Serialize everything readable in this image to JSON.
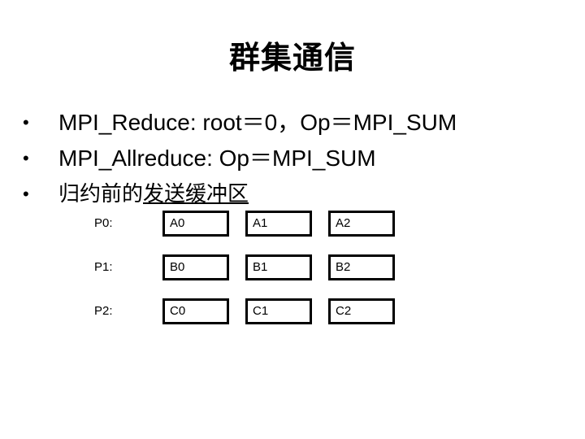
{
  "title": "群集通信",
  "bullets": [
    {
      "marker": "•",
      "text": "MPI_Reduce: root＝0，Op＝MPI_SUM"
    },
    {
      "marker": "•",
      "text": "MPI_Allreduce:  Op＝MPI_SUM"
    },
    {
      "marker": "•",
      "text_plain": "归约前的",
      "text_underlined": "发送缓冲区"
    }
  ],
  "buffer_table": {
    "rows": [
      {
        "label": "P0:",
        "cells": [
          "A0",
          "A1",
          "A2"
        ]
      },
      {
        "label": "P1:",
        "cells": [
          "B0",
          "B1",
          "B2"
        ]
      },
      {
        "label": "P2:",
        "cells": [
          "C0",
          "C1",
          "C2"
        ]
      }
    ]
  }
}
